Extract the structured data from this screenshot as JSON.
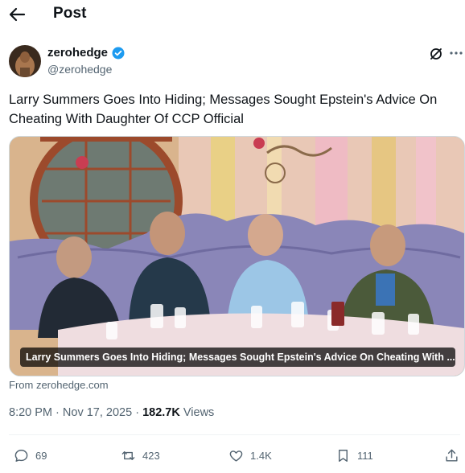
{
  "header": {
    "title": "Post"
  },
  "author": {
    "name": "zerohedge",
    "handle": "@zerohedge"
  },
  "post": {
    "text": "Larry Summers Goes Into Hiding; Messages Sought Epstein's Advice On Cheating With Daughter Of CCP Official",
    "link_card_caption": "Larry Summers Goes Into Hiding; Messages Sought Epstein's Advice On Cheating With ...",
    "source": "From zerohedge.com",
    "time": "8:20 PM",
    "date": "Nov 17, 2025",
    "separator": "·",
    "views_count": "182.7K",
    "views_label": "Views"
  },
  "actions": {
    "replies": "69",
    "reposts": "423",
    "likes": "1.4K",
    "bookmarks": "111"
  },
  "colors": {
    "verified": "#1d9bf0",
    "muted": "#536471",
    "text": "#0f1419"
  }
}
